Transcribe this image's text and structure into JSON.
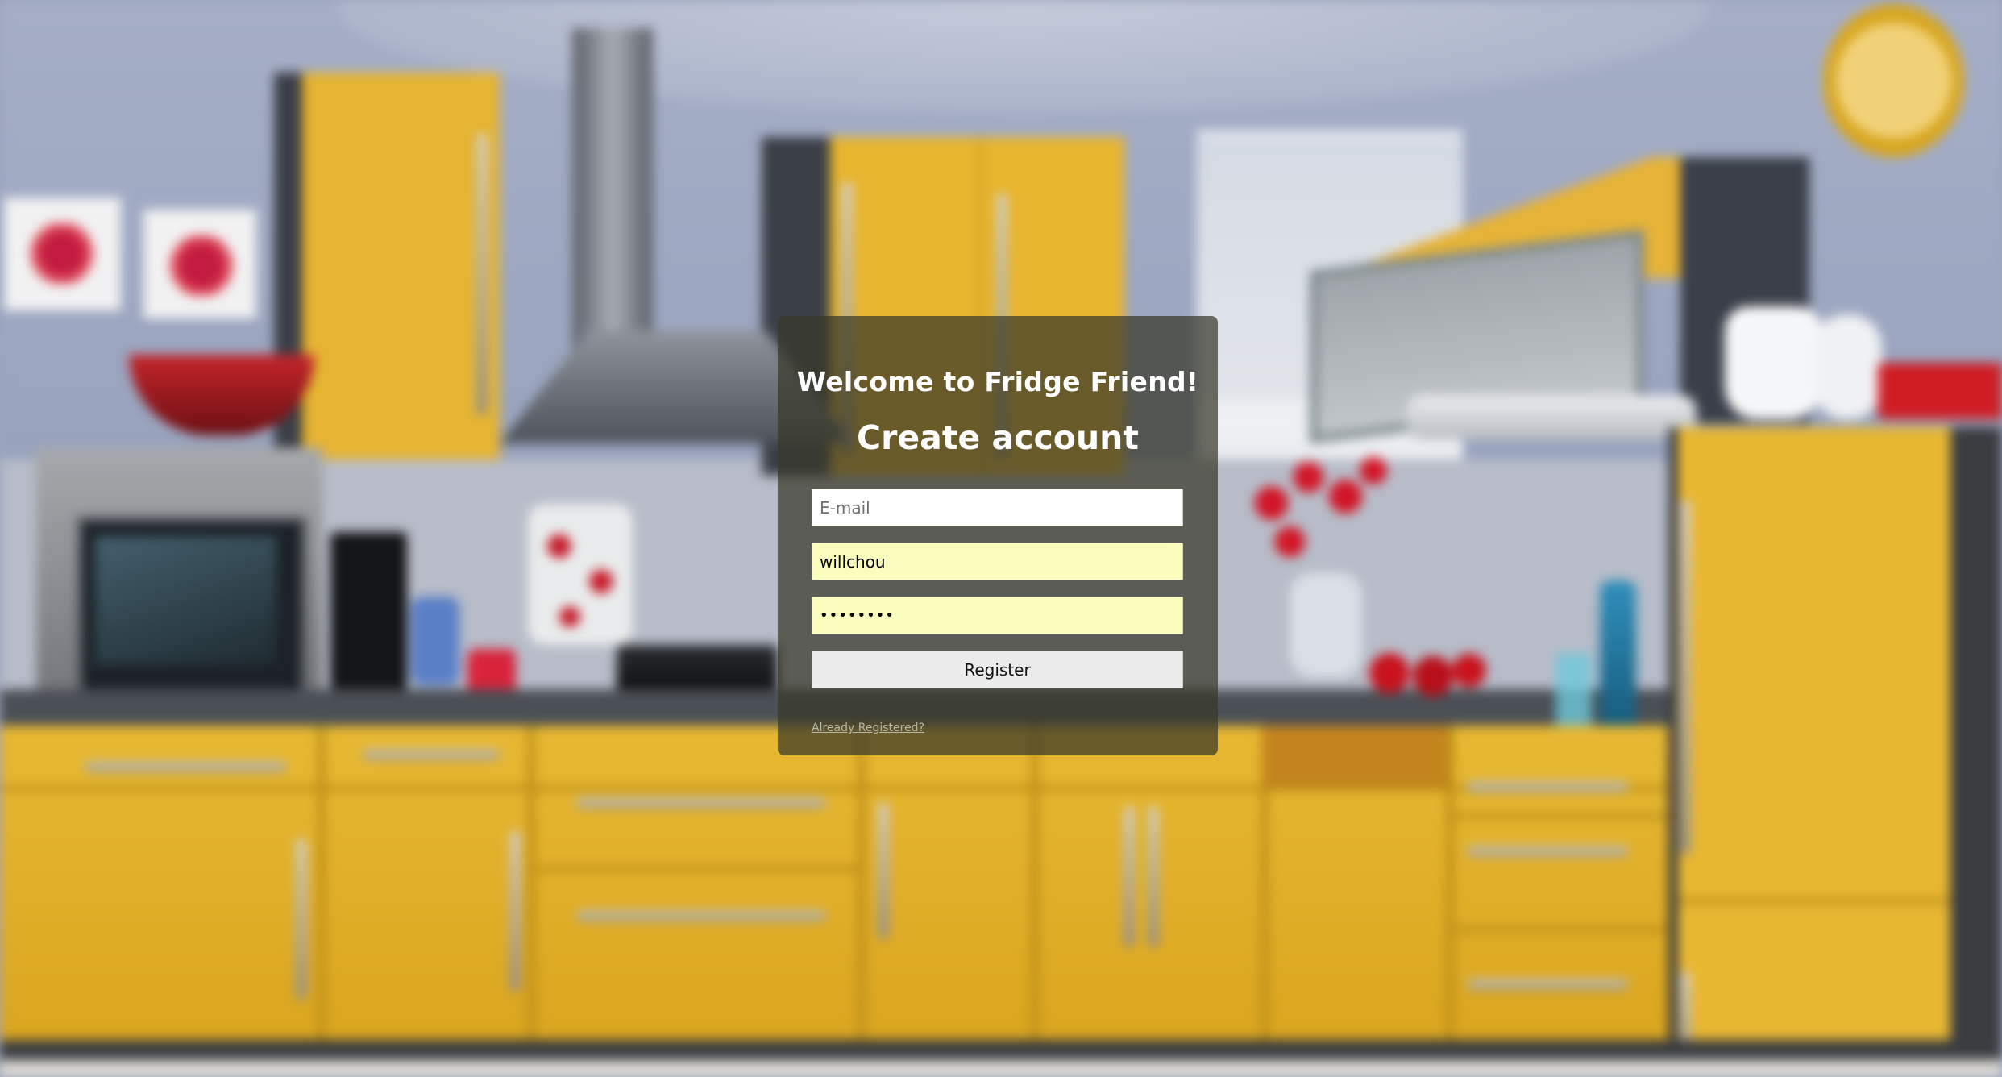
{
  "page": {
    "welcome_text": "Welcome to Fridge Friend!",
    "heading": "Create account"
  },
  "form": {
    "email": {
      "value": "",
      "placeholder": "E-mail"
    },
    "username": {
      "value": "willchou"
    },
    "password": {
      "value": "••••••••"
    },
    "register_label": "Register",
    "already_registered_link": "Already Registered?"
  },
  "colors": {
    "panel_background": "#373728",
    "autofill_field": "#fbfdbf",
    "button_background": "#ececec",
    "cabinet_yellow": "#e8b732"
  }
}
